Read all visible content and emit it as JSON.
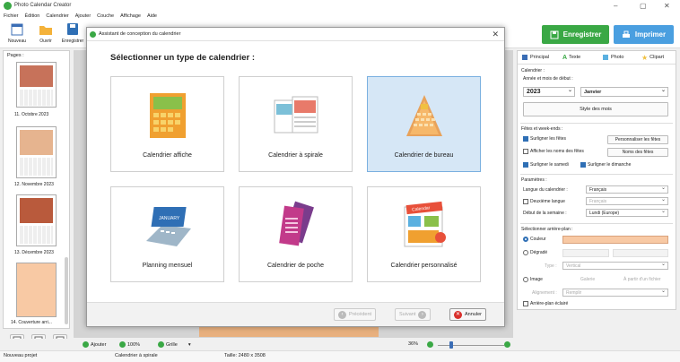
{
  "window": {
    "title": "Photo Calendar Creator",
    "minimize": "–",
    "maximize": "▢",
    "close": "✕"
  },
  "menu": [
    "Fichier",
    "Édition",
    "Calendrier",
    "Ajouter",
    "Couche",
    "Affichage",
    "Aide"
  ],
  "toolbar": {
    "new_label": "Nouveau",
    "open_label": "Ouvrir",
    "save_label": "Enregistrer",
    "save_big": "Enregistrer",
    "print_big": "Imprimer"
  },
  "pages_panel": {
    "title": "Pages :",
    "items": [
      "11. Octobre 2023",
      "12. Novembre 2023",
      "13. Décembre 2023",
      "14. Couverture arri..."
    ]
  },
  "dialog": {
    "title": "Assistant de conception du calendrier",
    "close": "✕",
    "heading": "Sélectionner un type de calendrier :",
    "types": [
      {
        "label": "Calendrier affiche",
        "selected": false
      },
      {
        "label": "Calendrier à spirale",
        "selected": false
      },
      {
        "label": "Calendrier de bureau",
        "selected": true
      },
      {
        "label": "Planning mensuel",
        "selected": false
      },
      {
        "label": "Calendrier de poche",
        "selected": false
      },
      {
        "label": "Calendrier personnalisé",
        "selected": false
      }
    ],
    "prev_label": "Précédent",
    "next_label": "Suivant",
    "cancel_label": "Annuler",
    "images": {
      "cal_banner": "Calendar",
      "planning": "JANUARY"
    }
  },
  "right_panel": {
    "tabs": [
      "Principal",
      "Texte",
      "Photo",
      "Clipart"
    ],
    "calendar_section": "Calendrier :",
    "start_label": "Année et mois de début :",
    "year": "2023",
    "month": "Janvier",
    "month_style": "Style des mois",
    "holidays_section": "Fêtes et week-ends :",
    "highlight_holidays": "Surligner les fêtes",
    "customize_holidays": "Personnaliser les fêtes",
    "show_holiday_names": "Afficher les noms des fêtes",
    "holiday_names": "Noms des fêtes",
    "highlight_saturday": "Surligner le samedi",
    "highlight_sunday": "Surligner le dimanche",
    "params_section": "Paramètres :",
    "lang_label": "Langue du calendrier :",
    "lang_value": "Français",
    "second_lang": "Deuxième langue",
    "second_lang_value": "Français",
    "week_start_label": "Début de la semaine :",
    "week_start_value": "Lundi (Europe)",
    "background_section": "Sélectionner arrière-plan :",
    "color_label": "Couleur",
    "gradient_label": "Dégradé",
    "type_label": "Type :",
    "type_value": "Vertical",
    "image_label": "Image",
    "gallery_label": "Galerie",
    "from_file_label": "À partir d'un fichier",
    "alignment_label": "Alignement :",
    "alignment_value": "Remplir",
    "lit_bg_label": "Arrière-plan éclairé"
  },
  "status": {
    "add": "Ajouter",
    "zoom_fit": "100%",
    "grid": "Grille",
    "zoom": "36%",
    "new_project": "Nouveau projet",
    "calendar_type": "Calendrier à spirale",
    "size": "Taille: 2480 x 3508"
  },
  "colors": {
    "green": "#3aa845",
    "blue": "#4a9fe0",
    "selected_card": "#d6e7f6",
    "peach": "#f8c9a4",
    "orange": "#f0a030"
  }
}
